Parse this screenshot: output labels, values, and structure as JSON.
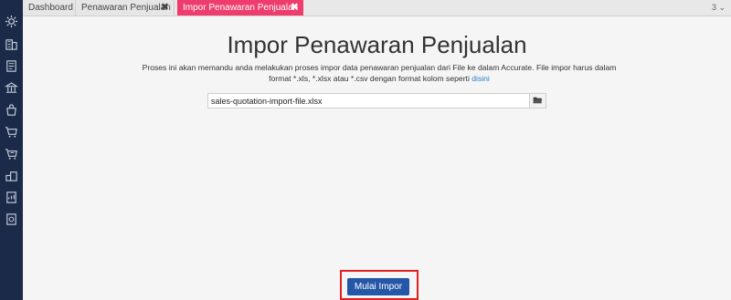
{
  "tabs": [
    {
      "label": "Dashboard",
      "closable": false,
      "active": false
    },
    {
      "label": "Penawaran Penjualan",
      "closable": true,
      "active": false
    },
    {
      "label": "Impor Penawaran Penjualan",
      "closable": true,
      "active": true
    }
  ],
  "tab_close_glyph": "✖",
  "tab_count": "3 ⌄",
  "sidebar": {
    "icons": [
      "gear-icon",
      "building-icon",
      "ledger-icon",
      "bank-icon",
      "shopping-bag-icon",
      "cart-icon",
      "cart-transfer-icon",
      "inventory-icon",
      "report-icon",
      "settings-report-icon"
    ]
  },
  "page": {
    "title": "Impor Penawaran Penjualan",
    "description": "Proses ini akan memandu anda melakukan proses impor data penawaran penjualan dari File ke dalam Accurate. File impor harus dalam format *.xls, *.xlsx atau *.csv dengan format kolom seperti",
    "link_text": "disini"
  },
  "file": {
    "value": "sales-quotation-import-file.xlsx",
    "button_icon": "folder-open-icon"
  },
  "actions": {
    "start_label": "Mulai Impor"
  },
  "colors": {
    "sidebar": "#1b2a48",
    "active_tab": "#ee3d6c",
    "primary_button": "#2457a8",
    "highlight": "#e02020",
    "link": "#2a7fc9"
  }
}
